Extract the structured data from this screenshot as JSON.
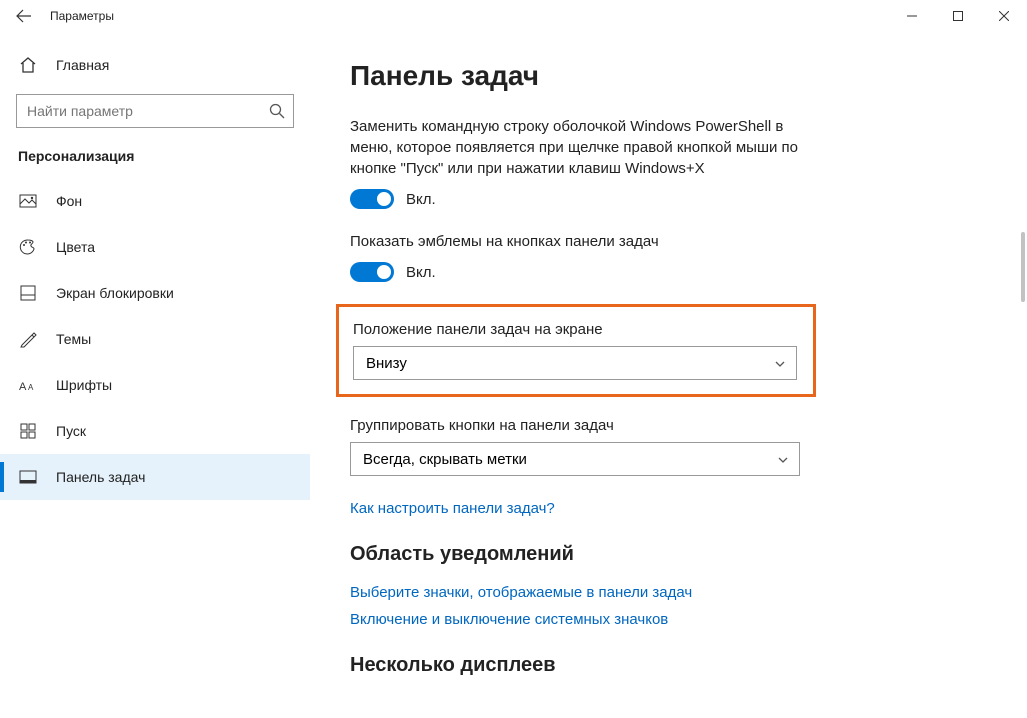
{
  "titlebar": {
    "title": "Параметры"
  },
  "sidebar": {
    "home": "Главная",
    "search_placeholder": "Найти параметр",
    "section": "Персонализация",
    "items": [
      {
        "label": "Фон"
      },
      {
        "label": "Цвета"
      },
      {
        "label": "Экран блокировки"
      },
      {
        "label": "Темы"
      },
      {
        "label": "Шрифты"
      },
      {
        "label": "Пуск"
      },
      {
        "label": "Панель задач"
      }
    ]
  },
  "content": {
    "heading": "Панель задач",
    "setting1_text": "Заменить командную строку оболочкой Windows PowerShell в меню, которое появляется при щелчке правой кнопкой мыши по кнопке \"Пуск\" или при нажатии клавиш Windows+X",
    "toggle_on": "Вкл.",
    "setting2_text": "Показать эмблемы на кнопках панели задач",
    "position_label": "Положение панели задач на экране",
    "position_value": "Внизу",
    "grouping_label": "Группировать кнопки на панели задач",
    "grouping_value": "Всегда, скрывать метки",
    "help_link": "Как настроить панели задач?",
    "section2": "Область уведомлений",
    "link_icons": "Выберите значки, отображаемые в панели задач",
    "link_system_icons": "Включение и выключение системных значков",
    "section3": "Несколько дисплеев"
  }
}
